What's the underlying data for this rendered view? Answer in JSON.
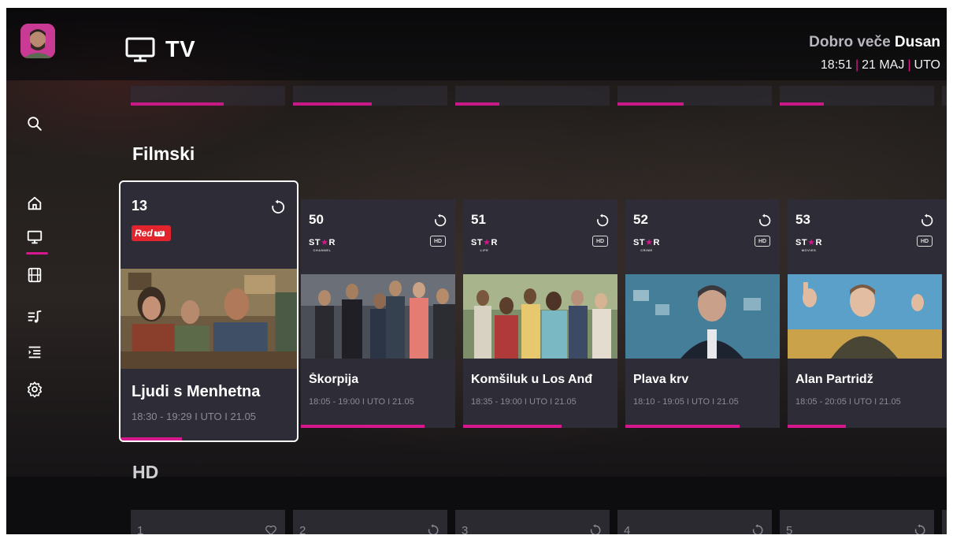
{
  "header": {
    "title": "TV",
    "greeting_prefix": "Dobro veče",
    "user_name": "Dusan",
    "time": "18:51",
    "date": "21 MAJ",
    "weekday": "UTO"
  },
  "sidebar": {
    "items": [
      {
        "icon": "search-icon"
      },
      {
        "icon": "home-icon"
      },
      {
        "icon": "tv-icon",
        "active": true
      },
      {
        "icon": "film-icon"
      },
      {
        "icon": "music-playlist-icon"
      },
      {
        "icon": "guide-list-icon"
      },
      {
        "icon": "gear-icon"
      }
    ]
  },
  "sections": {
    "current": "Filmski",
    "next": "HD"
  },
  "channels": [
    {
      "number": "13",
      "logo": "Red",
      "logo_suffix": "TV",
      "show": "Ljudi s Menhetna",
      "time": "18:30 - 19:29 I UTO I 21.05",
      "progress": 0.35
    },
    {
      "number": "50",
      "logo": "STAR",
      "logo_sub": "CHANNEL",
      "hd": "HD",
      "show": "Škorpija",
      "time": "18:05 - 19:00 I UTO I 21.05",
      "progress": 0.8
    },
    {
      "number": "51",
      "logo": "STAR",
      "logo_sub": "LIFE",
      "hd": "HD",
      "show": "Komšiluk u Los Anđ",
      "time": "18:35 - 19:00 I UTO I 21.05",
      "progress": 0.64
    },
    {
      "number": "52",
      "logo": "STAR",
      "logo_sub": "CRIME",
      "hd": "HD",
      "show": "Plava krv",
      "time": "18:10 - 19:05 I UTO I 21.05",
      "progress": 0.74
    },
    {
      "number": "53",
      "logo": "STAR",
      "logo_sub": "MOVIES",
      "hd": "HD",
      "show": "Alan Partridž",
      "time": "18:05 - 20:05 I UTO I 21.05",
      "progress": 0.38
    }
  ],
  "next_row": [
    {
      "number": "1",
      "icon": "heart-icon"
    },
    {
      "number": "2",
      "icon": "replay-icon"
    },
    {
      "number": "3",
      "icon": "replay-icon"
    },
    {
      "number": "4",
      "icon": "replay-icon"
    },
    {
      "number": "5",
      "icon": "replay-icon"
    }
  ],
  "colors": {
    "accent": "#d6188f",
    "card_bg": "#2e2c36",
    "red_tv": "#e2252d"
  }
}
